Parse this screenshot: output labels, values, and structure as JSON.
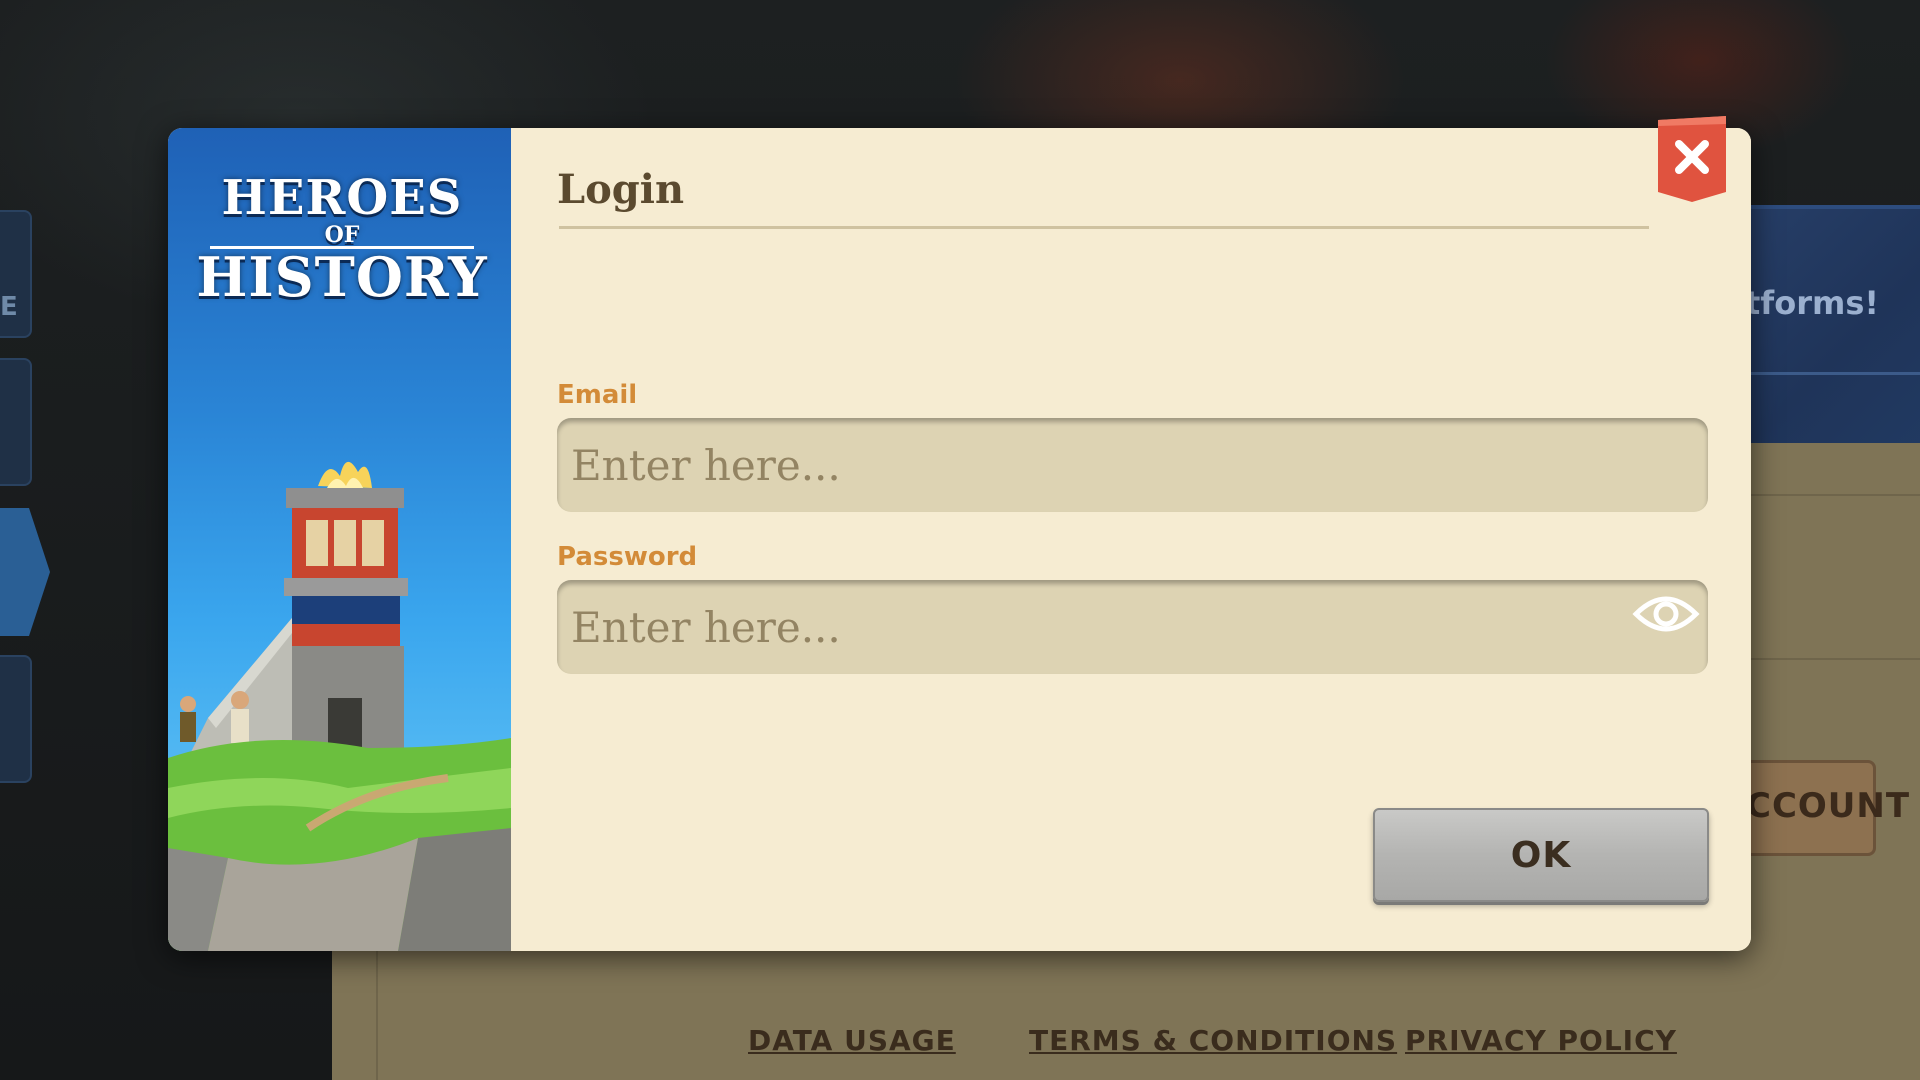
{
  "background": {
    "left_tab_fragment": "E",
    "banner_text": "tforms!",
    "account_button_fragment": "CCOUNT",
    "footer_links": [
      "DATA USAGE",
      "TERMS & CONDITIONS",
      "PRIVACY POLICY"
    ]
  },
  "dialog": {
    "logo": {
      "line1": "HEROES",
      "line2": "OF",
      "line3": "HISTORY"
    },
    "title": "Login",
    "email": {
      "label": "Email",
      "placeholder": "Enter here...",
      "value": ""
    },
    "password": {
      "label": "Password",
      "placeholder": "Enter here...",
      "value": ""
    },
    "ok_label": "OK",
    "icons": {
      "close": "close-icon",
      "reveal_password": "eye-icon"
    }
  },
  "colors": {
    "dialog_bg": "#f6ecd2",
    "field_label": "#d38b38",
    "field_bg": "#ddd3b3",
    "close_button": "#e0533f",
    "ok_button": "#b4b4b2"
  }
}
